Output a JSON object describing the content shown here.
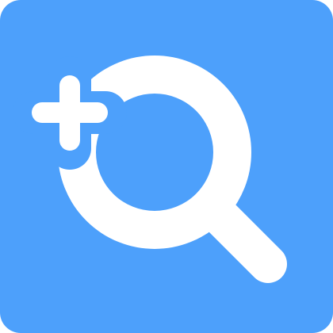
{
  "icon": {
    "name": "zoom-in",
    "background_color": "#4da0fb",
    "glyph_color": "#ffffff",
    "parts": [
      "magnifier-icon",
      "plus-icon"
    ]
  }
}
